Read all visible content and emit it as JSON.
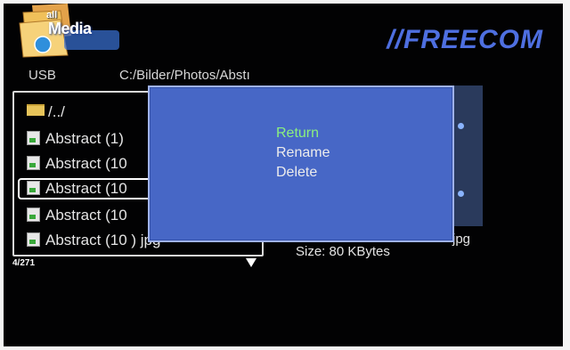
{
  "header": {
    "logo_small": "all",
    "logo_big": "Media",
    "brand": "//FREECOM"
  },
  "browser": {
    "source": "USB",
    "path": "C:/Bilder/Photos/Abstı",
    "parent_dir": "/../",
    "files": [
      "Abstract (1)",
      "Abstract (10",
      "Abstract (10",
      "Abstract (10",
      "Abstract (10 ) jpg"
    ],
    "selected_index": 2,
    "position": "4/271"
  },
  "info": {
    "extension": "jpg",
    "size": "Size: 80 KBytes"
  },
  "dialog": {
    "items": [
      "Return",
      "Rename",
      "Delete"
    ],
    "active_index": 0
  },
  "colors": {
    "dialog_bg": "#4767c6",
    "active_item": "#8bf07e",
    "brand": "#4e6fe0"
  }
}
